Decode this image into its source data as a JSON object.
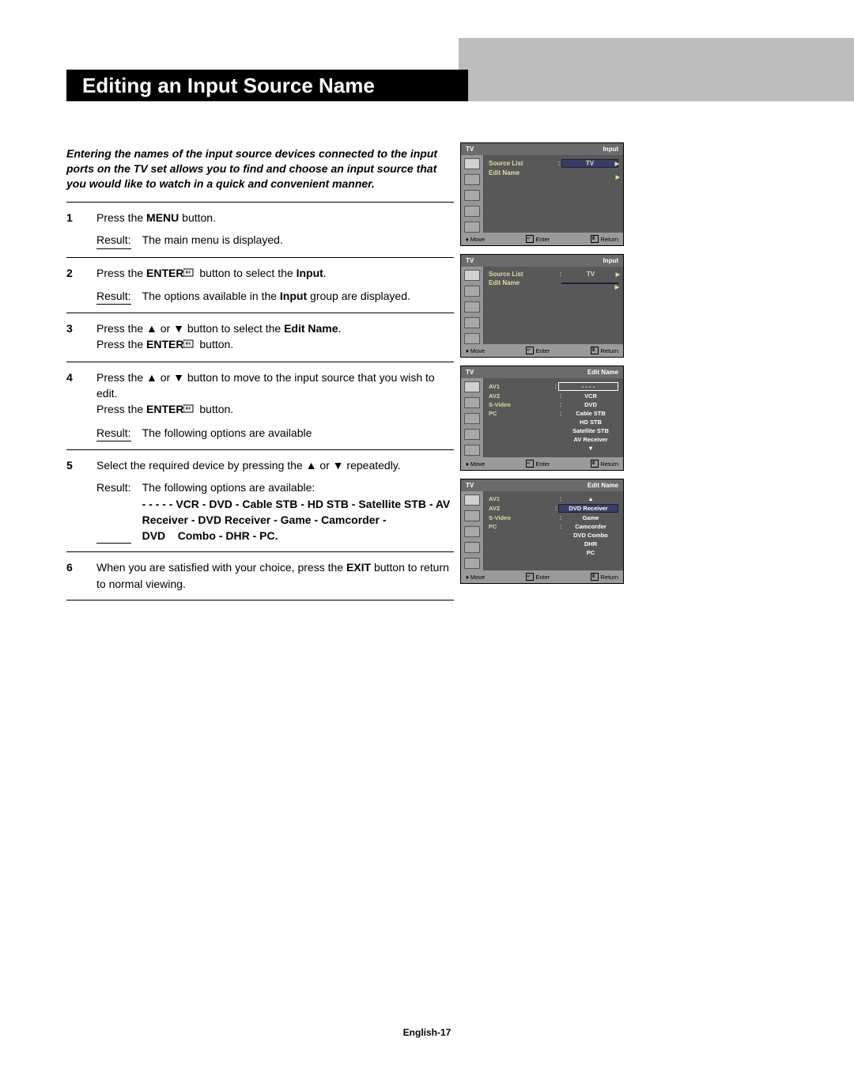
{
  "title": "Editing an Input Source Name",
  "intro": "Entering the names of the input source devices connected to the input ports on the TV set allows you to find and choose an input source that you would like to watch in a quick and convenient manner.",
  "page_footer": "English-17",
  "steps": {
    "s1": {
      "num": "1",
      "text_a": "Press the ",
      "bold_a": "MENU",
      "text_b": " button.",
      "result": "The main menu is displayed."
    },
    "s2": {
      "num": "2",
      "text_a": "Press the ",
      "bold_a": "ENTER",
      "text_b": " button to select the ",
      "bold_b": "Input",
      "text_c": ".",
      "result_a": "The options available in the ",
      "result_bold": "Input",
      "result_b": " group are displayed."
    },
    "s3": {
      "num": "3",
      "text_a": "Press the ▲ or ▼ button to select the ",
      "bold_a": "Edit Name",
      "text_b": ".",
      "line2_a": "Press the ",
      "line2_bold": "ENTER",
      "line2_b": " button."
    },
    "s4": {
      "num": "4",
      "text_a": "Press the ▲ or ▼ button to move to the input source that you wish to edit.",
      "line2_a": "Press the ",
      "line2_bold": "ENTER",
      "line2_b": " button.",
      "result": "The following options are available"
    },
    "s5": {
      "num": "5",
      "text_a": "Select the required device by pressing the ▲ or ▼ repeatedly.",
      "result": "The following options are available:",
      "options": "- - - - - VCR - DVD - Cable STB - HD STB - Satellite STB - AV Receiver - DVD Receiver - Game - Camcorder - DVD    Combo - DHR - PC."
    },
    "s6": {
      "num": "6",
      "text_a": "When you are satisfied with your choice, press the ",
      "bold_a": "EXIT",
      "text_b": " button to return to normal viewing."
    }
  },
  "osd": {
    "footbar": {
      "move": "Move",
      "enter": "Enter",
      "return": "Return"
    },
    "p1": {
      "tl": "TV",
      "tr": "Input",
      "rows": [
        {
          "label": "Source List",
          "value": "TV",
          "sel": true
        },
        {
          "label": "Edit Name",
          "value": "",
          "sel": false
        }
      ]
    },
    "p2": {
      "tl": "TV",
      "tr": "Input",
      "rows": [
        {
          "label": "Source List",
          "value": "TV",
          "sel": false
        },
        {
          "label": "Edit Name",
          "value": "",
          "sel": true
        }
      ]
    },
    "p3": {
      "tl": "TV",
      "tr": "Edit Name",
      "rows": [
        {
          "label": "AV1",
          "value": "- - - -",
          "sel": true
        },
        {
          "label": "AV2",
          "value": "VCR"
        },
        {
          "label": "S-Video",
          "value": "DVD"
        },
        {
          "label": "PC",
          "value": "Cable STB"
        },
        {
          "label": "",
          "value": "HD STB"
        },
        {
          "label": "",
          "value": "Satellite STB"
        },
        {
          "label": "",
          "value": "AV Receiver"
        },
        {
          "label": "",
          "value": "▼"
        }
      ]
    },
    "p4": {
      "tl": "TV",
      "tr": "Edit Name",
      "rows": [
        {
          "label": "AV1",
          "value": "▲",
          "sel": false
        },
        {
          "label": "AV2",
          "value": "DVD Receiver",
          "sel": true
        },
        {
          "label": "S-Video",
          "value": "Game"
        },
        {
          "label": "PC",
          "value": "Camcorder"
        },
        {
          "label": "",
          "value": "DVD Combo"
        },
        {
          "label": "",
          "value": "DHR"
        },
        {
          "label": "",
          "value": "PC"
        }
      ]
    }
  },
  "result_label": "Result:"
}
